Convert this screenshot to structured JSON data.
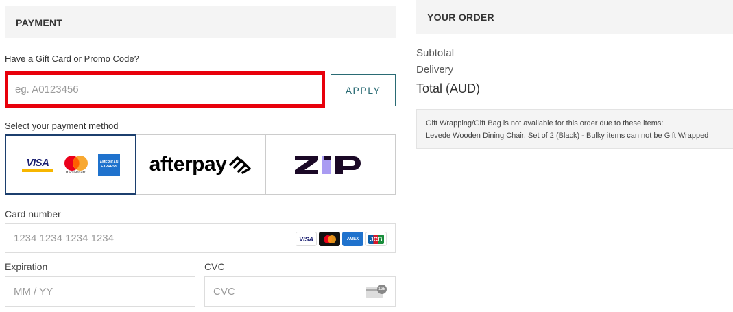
{
  "payment": {
    "header": "PAYMENT",
    "promo_label": "Have a Gift Card or Promo Code?",
    "promo_placeholder": "eg. A0123456",
    "apply_label": "APPLY",
    "method_label": "Select your payment method",
    "methods": [
      {
        "name": "card",
        "brands": [
          "VISA",
          "mastercard",
          "AMERICAN EXPRESS"
        ],
        "selected": true
      },
      {
        "name": "afterpay",
        "text": "afterpay",
        "selected": false
      },
      {
        "name": "zip",
        "text": "zip",
        "selected": false
      }
    ],
    "card_number_label": "Card number",
    "card_number_placeholder": "1234 1234 1234 1234",
    "card_brands": [
      "VISA",
      "mastercard",
      "AMEX",
      "JCB"
    ],
    "expiration_label": "Expiration",
    "expiration_placeholder": "MM / YY",
    "cvc_label": "CVC",
    "cvc_placeholder": "CVC",
    "cvc_icon_text": "135"
  },
  "order": {
    "header": "YOUR ORDER",
    "subtotal_label": "Subtotal",
    "delivery_label": "Delivery",
    "total_label": "Total (AUD)",
    "notice_line1": "Gift Wrapping/Gift Bag is not available for this order due to these items:",
    "notice_line2": "Levede Wooden Dining Chair, Set of 2 (Black) - Bulky items can not be Gift Wrapped"
  },
  "colors": {
    "highlight_border": "#e8000b",
    "apply_teal": "#2a6b74",
    "selected_border": "#1c3f6e",
    "zip_purple": "#a99bf2"
  }
}
